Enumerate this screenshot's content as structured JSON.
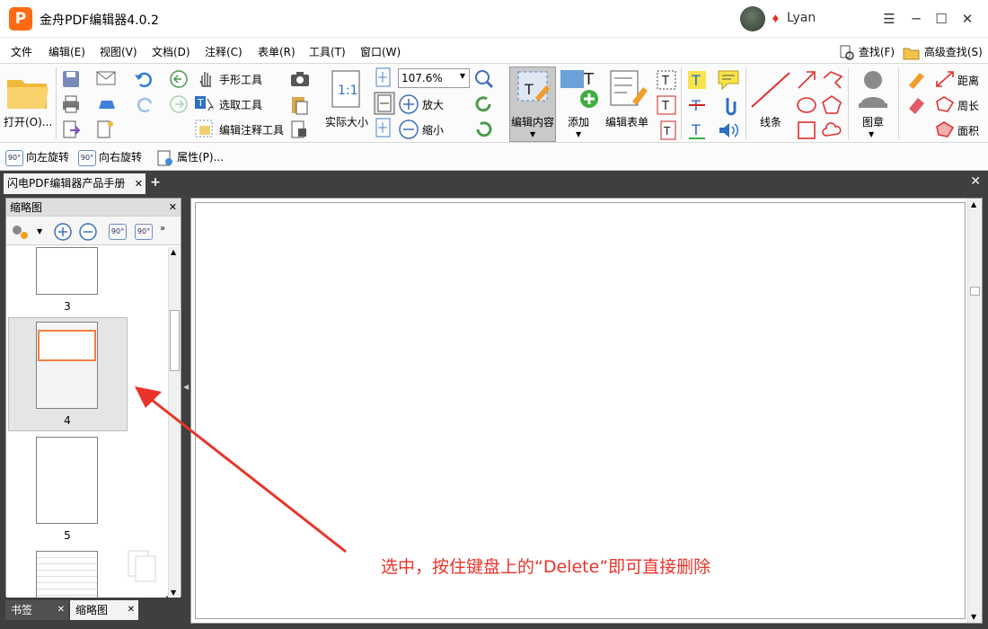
{
  "titlebar": {
    "app_logo": "P",
    "title": "金舟PDF编辑器4.0.2",
    "user": "Lyan"
  },
  "menu": {
    "items": [
      "文件",
      "编辑(E)",
      "视图(V)",
      "文档(D)",
      "注释(C)",
      "表单(R)",
      "工具(T)",
      "窗口(W)"
    ],
    "search": "查找(F)",
    "advanced_search": "高级查找(S)"
  },
  "ribbon": {
    "open": "打开(O)...",
    "hand_tool": "手形工具",
    "select_tool": "选取工具",
    "edit_annotation_tool": "编辑注释工具",
    "actual_size": "实际大小",
    "zoom_value": "107.6%",
    "zoom_in": "放大",
    "zoom_out": "缩小",
    "edit_content": "编辑内容",
    "add": "添加",
    "edit_form": "编辑表单",
    "line": "线条",
    "stamp": "图章",
    "distance": "距离",
    "perimeter": "周长",
    "area": "面积"
  },
  "toolbar2": {
    "rotate_left": "向左旋转",
    "rotate_right": "向右旋转",
    "properties": "属性(P)...",
    "rotate_badge": "90°"
  },
  "tabs": {
    "document": "闪电PDF编辑器产品手册"
  },
  "left_panel": {
    "title": "缩略图",
    "rotate_badge": "90°",
    "pages": [
      {
        "number": "3",
        "selected": false
      },
      {
        "number": "4",
        "selected": true
      },
      {
        "number": "5",
        "selected": false
      }
    ],
    "bottom_tabs": [
      "书签",
      "缩略图"
    ]
  },
  "annotation_text": "选中，按住键盘上的“Delete”即可直接删除",
  "colors": {
    "accent_red": "#e8342a",
    "brand_orange": "#ff6a13",
    "panel_dark": "#3f3f3f"
  }
}
